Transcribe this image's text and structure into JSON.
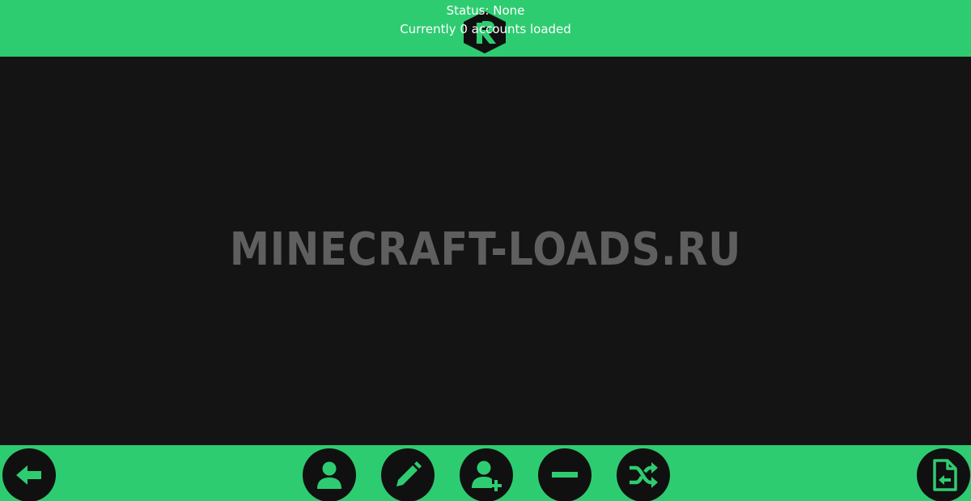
{
  "header": {
    "status_text": "Status: None",
    "accounts_text": "Currently 0 accounts loaded",
    "logo_icon": "hexagon-r-logo-icon"
  },
  "main": {
    "watermark": "MINECRAFT-LOADS.RU"
  },
  "toolbar": {
    "buttons": [
      {
        "name": "back-button",
        "icon": "arrow-left-icon"
      },
      {
        "name": "login-button",
        "icon": "user-icon"
      },
      {
        "name": "edit-account-button",
        "icon": "pencil-icon"
      },
      {
        "name": "add-account-button",
        "icon": "user-plus-icon"
      },
      {
        "name": "remove-account-button",
        "icon": "minus-icon"
      },
      {
        "name": "random-account-button",
        "icon": "shuffle-icon"
      },
      {
        "name": "import-accounts-button",
        "icon": "file-import-icon"
      }
    ]
  },
  "colors": {
    "accent": "#2ecc71",
    "background": "#141414",
    "button_fill": "#101010",
    "text": "#ffffff",
    "watermark": "#5f5f5f"
  }
}
